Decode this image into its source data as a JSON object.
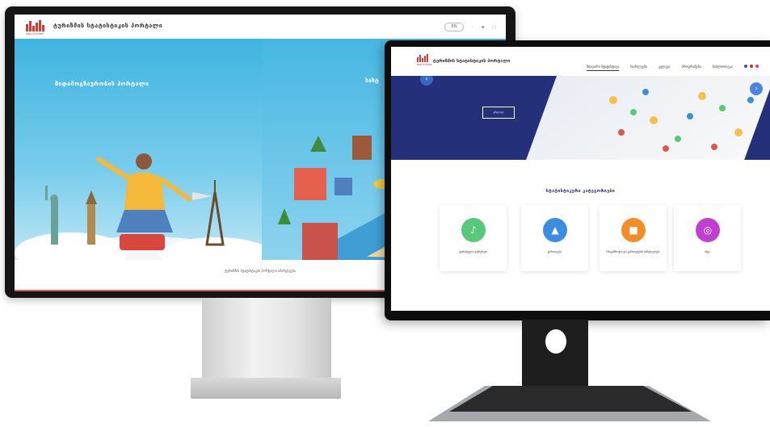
{
  "back_monitor": {
    "logo_text": "EIMA SYSTEMS",
    "site_title": "ტურიზმის სტატისტიკის პორტალი",
    "lang_toggle": "EN",
    "hero_text_left": "შიდამოგზაურობის პორტალი",
    "hero_text_right": "სასტ",
    "footer_text": "ტურიზმის სტატისტიკის პორტალი ამარცხვება"
  },
  "front_monitor": {
    "logo_text": "EIMA SYSTEMS",
    "site_title": "ტურიზმის სტატისტიკის პორტალი",
    "nav": [
      "მთავარი სტატისტიკა",
      "სიახლეები",
      "კვლევა",
      "პროგრამები",
      "ბიბლიოთეკა"
    ],
    "banner_button": "ვრცლად",
    "section_title": "სტატისტიკური კატეგორიები",
    "cards": [
      {
        "label": "ტურისტული ვაუჩერები",
        "icon": "mic-icon",
        "color": "#58c97a"
      },
      {
        "label": "განათლება",
        "icon": "graduation-cap-icon",
        "color": "#3b8de0"
      },
      {
        "label": "სასტუმროები და განთავსების საშუალებები",
        "icon": "hotel-icon",
        "color": "#f28d28"
      },
      {
        "label": "სხვა",
        "icon": "globe-icon",
        "color": "#c13fd0"
      }
    ]
  }
}
